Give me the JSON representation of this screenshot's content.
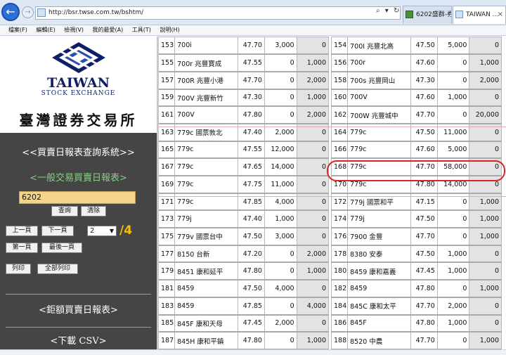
{
  "browser": {
    "url": "http://bsr.twse.com.tw/bshtm/",
    "address_tools": "⌕ ▾ ↻",
    "tabs": [
      {
        "label": "6202盛群-券..."
      },
      {
        "label": "TAIWAN ..."
      }
    ],
    "close_glyph": "×",
    "back_glyph": "←",
    "forward_glyph": "→"
  },
  "menu": [
    "檔案(F)",
    "編輯(E)",
    "檢視(V)",
    "我的最愛(A)",
    "工具(T)",
    "說明(H)"
  ],
  "sidebar": {
    "logo_en_title": "TAIWAN",
    "logo_en_sub": "STOCK EXCHANGE",
    "logo_zh": "臺灣證券交易所",
    "heading_query_system": "<<買賣日報表查詢系統>>",
    "heading_general": "<一般交易買賣日報表>",
    "stock_code": "6202",
    "btn_query": "查詢",
    "btn_clear": "清除",
    "btn_prev": "上一頁",
    "btn_next": "下一頁",
    "page_current": "2",
    "page_total": "/4",
    "btn_first": "第一頁",
    "btn_last": "最後一頁",
    "btn_print": "列印",
    "btn_print_all": "全部列印",
    "heading_block": "<鉅額買賣日報表>",
    "heading_csv": "<下載 CSV>"
  },
  "table_left": [
    {
      "seq": "153",
      "broker": "700i",
      "price": "47.70",
      "buy": "3,000",
      "sell": "0"
    },
    {
      "seq": "155",
      "broker": "700r 兆豐寶成",
      "price": "47.55",
      "buy": "0",
      "sell": "1,000"
    },
    {
      "seq": "157",
      "broker": "700R 兆豐小港",
      "price": "47.70",
      "buy": "0",
      "sell": "2,000"
    },
    {
      "seq": "159",
      "broker": "700V 兆豐新竹",
      "price": "47.30",
      "buy": "0",
      "sell": "1,000"
    },
    {
      "seq": "161",
      "broker": "700V",
      "price": "47.80",
      "buy": "0",
      "sell": "2,000"
    },
    {
      "seq": "163",
      "broker": "779c 國票敦北",
      "price": "47.40",
      "buy": "2,000",
      "sell": "0"
    },
    {
      "seq": "165",
      "broker": "779c",
      "price": "47.55",
      "buy": "12,000",
      "sell": "0"
    },
    {
      "seq": "167",
      "broker": "779c",
      "price": "47.65",
      "buy": "14,000",
      "sell": "0"
    },
    {
      "seq": "169",
      "broker": "779c",
      "price": "47.75",
      "buy": "11,000",
      "sell": "0"
    },
    {
      "seq": "171",
      "broker": "779c",
      "price": "47.85",
      "buy": "4,000",
      "sell": "0"
    },
    {
      "seq": "173",
      "broker": "779j",
      "price": "47.40",
      "buy": "1,000",
      "sell": "0"
    },
    {
      "seq": "175",
      "broker": "779v 國票台中",
      "price": "47.50",
      "buy": "3,000",
      "sell": "0"
    },
    {
      "seq": "177",
      "broker": "8150 台新",
      "price": "47.20",
      "buy": "0",
      "sell": "2,000"
    },
    {
      "seq": "179",
      "broker": "8451 康和延平",
      "price": "47.80",
      "buy": "0",
      "sell": "1,000"
    },
    {
      "seq": "181",
      "broker": "8459",
      "price": "47.50",
      "buy": "4,000",
      "sell": "0"
    },
    {
      "seq": "183",
      "broker": "8459",
      "price": "47.85",
      "buy": "0",
      "sell": "4,000"
    },
    {
      "seq": "185",
      "broker": "845F 康和天母",
      "price": "47.45",
      "buy": "2,000",
      "sell": "0"
    },
    {
      "seq": "187",
      "broker": "845H 康和平鎮",
      "price": "47.80",
      "buy": "0",
      "sell": "1,000"
    }
  ],
  "table_right": [
    {
      "seq": "154",
      "broker": "700I 兆豐北高",
      "price": "47.50",
      "buy": "5,000",
      "sell": "0"
    },
    {
      "seq": "156",
      "broker": "700r",
      "price": "47.60",
      "buy": "0",
      "sell": "1,000"
    },
    {
      "seq": "158",
      "broker": "700s 兆豐岡山",
      "price": "47.30",
      "buy": "0",
      "sell": "2,000"
    },
    {
      "seq": "160",
      "broker": "700V",
      "price": "47.60",
      "buy": "1,000",
      "sell": "0"
    },
    {
      "seq": "162",
      "broker": "700W 兆豐城中",
      "price": "47.70",
      "buy": "0",
      "sell": "20,000"
    },
    {
      "seq": "164",
      "broker": "779c",
      "price": "47.50",
      "buy": "11,000",
      "sell": "0"
    },
    {
      "seq": "166",
      "broker": "779c",
      "price": "47.60",
      "buy": "5,000",
      "sell": "0"
    },
    {
      "seq": "168",
      "broker": "779c",
      "price": "47.70",
      "buy": "58,000",
      "sell": "0"
    },
    {
      "seq": "170",
      "broker": "779c",
      "price": "47.80",
      "buy": "14,000",
      "sell": "0"
    },
    {
      "seq": "172",
      "broker": "779j 國票和平",
      "price": "47.15",
      "buy": "0",
      "sell": "1,000"
    },
    {
      "seq": "174",
      "broker": "779j",
      "price": "47.50",
      "buy": "0",
      "sell": "1,000"
    },
    {
      "seq": "176",
      "broker": "7900 金豐",
      "price": "47.70",
      "buy": "0",
      "sell": "1,000"
    },
    {
      "seq": "178",
      "broker": "8380 安泰",
      "price": "47.50",
      "buy": "1,000",
      "sell": "0"
    },
    {
      "seq": "180",
      "broker": "8459 康和嘉義",
      "price": "47.45",
      "buy": "1,000",
      "sell": "0"
    },
    {
      "seq": "182",
      "broker": "8459",
      "price": "47.80",
      "buy": "0",
      "sell": "1,000"
    },
    {
      "seq": "184",
      "broker": "845C 康和太平",
      "price": "47.70",
      "buy": "2,000",
      "sell": "0"
    },
    {
      "seq": "186",
      "broker": "845F",
      "price": "47.80",
      "buy": "1,000",
      "sell": "0"
    },
    {
      "seq": "188",
      "broker": "8520 中農",
      "price": "47.70",
      "buy": "0",
      "sell": "1,000"
    }
  ],
  "colors": {
    "highlight": "#d8232a",
    "group_box": "#e3a7c0",
    "sidebar_bg": "#454545"
  }
}
